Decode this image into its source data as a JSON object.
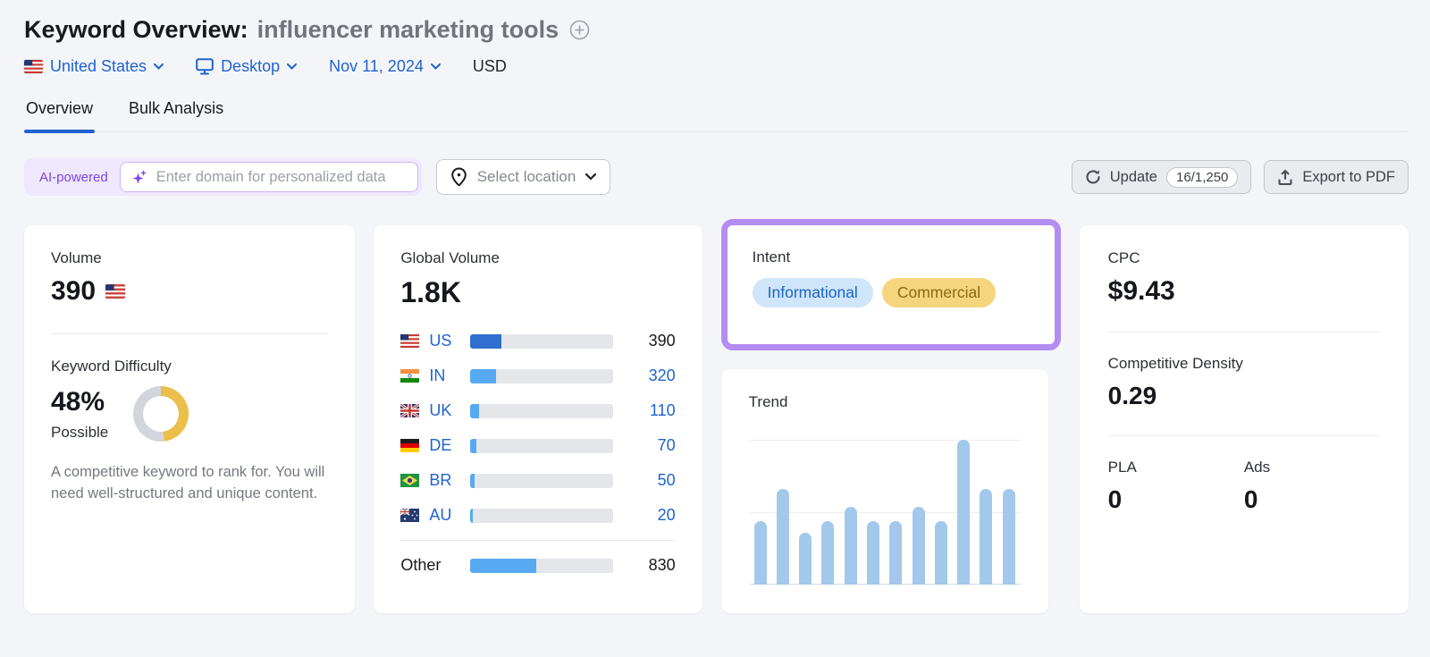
{
  "header": {
    "title": "Keyword Overview:",
    "keyword": "influencer marketing tools",
    "filters": {
      "location": "United States",
      "device": "Desktop",
      "date": "Nov 11, 2024",
      "currency": "USD"
    }
  },
  "tabs": [
    {
      "label": "Overview",
      "active": true
    },
    {
      "label": "Bulk Analysis",
      "active": false
    }
  ],
  "toolbar": {
    "ai_badge": "AI-powered",
    "domain_placeholder": "Enter domain for personalized data",
    "select_location": "Select location",
    "update_label": "Update",
    "update_counter": "16/1,250",
    "export_label": "Export to PDF"
  },
  "cards": {
    "volume": {
      "label": "Volume",
      "value": "390"
    },
    "keyword_difficulty": {
      "label": "Keyword Difficulty",
      "value": "48%",
      "percent": 48,
      "level": "Possible",
      "description": "A competitive keyword to rank for. You will need well-structured and unique content."
    },
    "global_volume": {
      "label": "Global Volume",
      "value": "1.8K",
      "rows": [
        {
          "code": "US",
          "value": "390",
          "share": 0.218,
          "active": true
        },
        {
          "code": "IN",
          "value": "320",
          "share": 0.179,
          "active": false
        },
        {
          "code": "UK",
          "value": "110",
          "share": 0.061,
          "active": false
        },
        {
          "code": "DE",
          "value": "70",
          "share": 0.039,
          "active": false
        },
        {
          "code": "BR",
          "value": "50",
          "share": 0.028,
          "active": false
        },
        {
          "code": "AU",
          "value": "20",
          "share": 0.018,
          "active": false
        }
      ],
      "other": {
        "label": "Other",
        "value": "830",
        "share": 0.464
      }
    },
    "intent": {
      "label": "Intent",
      "badges": [
        {
          "label": "Informational",
          "type": "informational"
        },
        {
          "label": "Commercial",
          "type": "commercial"
        }
      ]
    },
    "trend": {
      "label": "Trend"
    },
    "cpc": {
      "label": "CPC",
      "value": "$9.43"
    },
    "competitive_density": {
      "label": "Competitive Density",
      "value": "0.29"
    },
    "pla": {
      "label": "PLA",
      "value": "0"
    },
    "ads": {
      "label": "Ads",
      "value": "0"
    }
  },
  "chart_data": [
    {
      "type": "bar",
      "orientation": "horizontal",
      "title": "Global Volume by country",
      "categories": [
        "US",
        "IN",
        "UK",
        "DE",
        "BR",
        "AU",
        "Other"
      ],
      "values": [
        390,
        320,
        110,
        70,
        50,
        20,
        830
      ],
      "total_label": "1.8K",
      "highlighted_category": "US"
    },
    {
      "type": "bar",
      "title": "Trend",
      "categories": [
        "",
        "",
        "",
        "",
        "",
        "",
        "",
        "",
        "",
        "",
        "",
        ""
      ],
      "values": [
        0.44,
        0.66,
        0.36,
        0.44,
        0.54,
        0.44,
        0.44,
        0.54,
        0.44,
        1.0,
        0.66,
        0.66
      ],
      "ylim": [
        0,
        1
      ],
      "grid": "horizontal lines at 0%, 50%, 100%",
      "note": "12 unlabeled monthly bars, heights normalized to tallest bar"
    }
  ],
  "colors": {
    "link_blue": "#1f63cf",
    "tab_underline": "#1f63cf",
    "purple_frame": "#b38df2",
    "ai_purple": "#7a44e0",
    "kd_yellow": "#ecbf4a",
    "kd_track": "#d2d5db",
    "bar_active": "#2e6fd0",
    "bar_blue": "#57a9f2",
    "trend_bar": "#a2c9eb",
    "intent_informational_bg": "#cfe5fa",
    "intent_informational_text": "#1b65c7",
    "intent_commercial_bg": "#f5d57e",
    "intent_commercial_text": "#8a6a14"
  }
}
